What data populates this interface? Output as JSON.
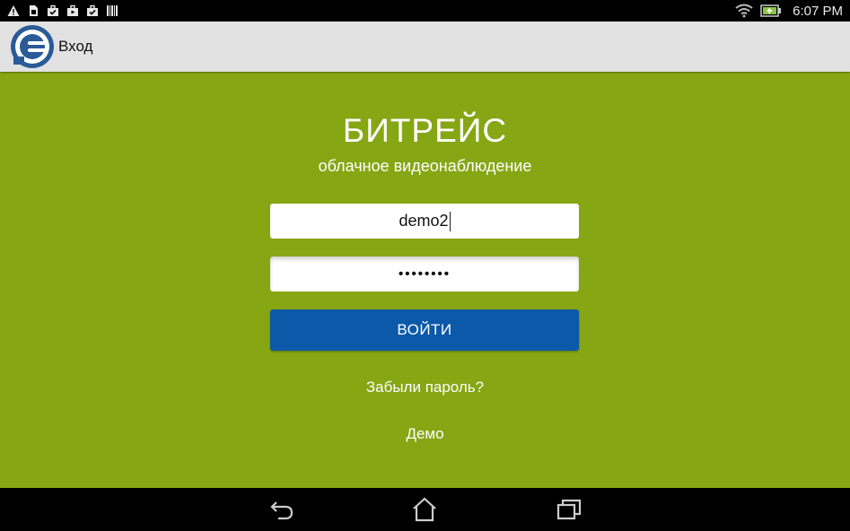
{
  "status_bar": {
    "time": "6:07 PM",
    "left_icons": [
      "warning-icon",
      "sim-card-icon",
      "briefcase-check-icon",
      "briefcase-play-icon",
      "briefcase-check-icon",
      "barcode-icon"
    ],
    "right_icons": [
      "wifi-icon",
      "battery-charging-icon"
    ]
  },
  "action_bar": {
    "title": "Вход",
    "logo_icon": "bitreis-logo-icon"
  },
  "login": {
    "brand": "БИТРЕЙС",
    "tagline": "облачное видеонаблюдение",
    "username_value": "demo2",
    "password_masked": "••••••••",
    "login_button": "ВОЙТИ",
    "forgot_password": "Забыли пароль?",
    "demo": "Демо"
  },
  "nav_bar": {
    "buttons": [
      "back-icon",
      "home-icon",
      "recent-apps-icon"
    ]
  },
  "colors": {
    "background": "#86a614",
    "button": "#0b59a8",
    "action_bar": "#e2e2e2"
  }
}
